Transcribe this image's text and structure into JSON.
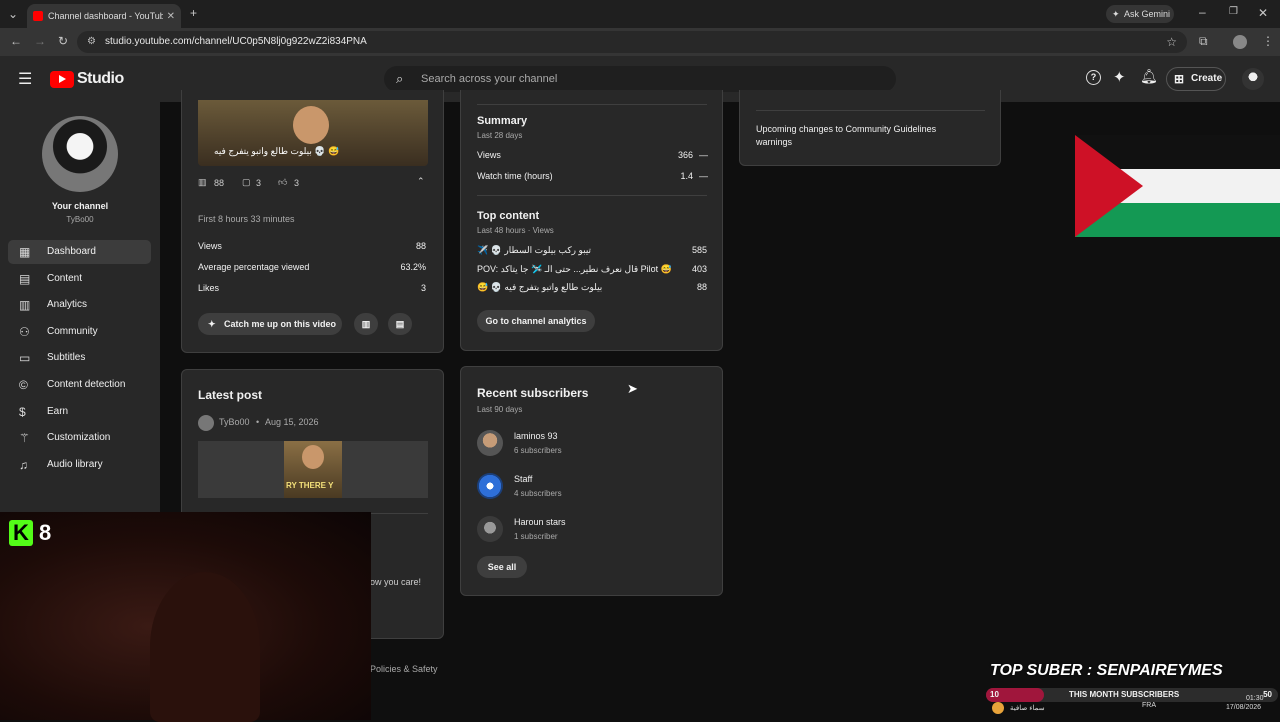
{
  "browser": {
    "tab_title": "Channel dashboard - YouTube Studio",
    "ask_gemini": "Ask Gemini",
    "url": "studio.youtube.com/channel/UC0p5N8lj0g922wZ2i834PNA"
  },
  "header": {
    "logo_text": "Studio",
    "search_placeholder": "Search across your channel",
    "create_label": "Create"
  },
  "sidebar": {
    "your_channel": "Your channel",
    "channel_name": "TyBo00",
    "items": [
      {
        "label": "Dashboard",
        "icon": "dashboard-icon"
      },
      {
        "label": "Content",
        "icon": "content-icon"
      },
      {
        "label": "Analytics",
        "icon": "analytics-icon"
      },
      {
        "label": "Community",
        "icon": "community-icon"
      },
      {
        "label": "Subtitles",
        "icon": "subtitles-icon"
      },
      {
        "label": "Content detection",
        "icon": "copyright-icon"
      },
      {
        "label": "Earn",
        "icon": "dollar-icon"
      },
      {
        "label": "Customization",
        "icon": "wand-icon"
      },
      {
        "label": "Audio library",
        "icon": "audio-library-icon"
      }
    ]
  },
  "latest_video": {
    "thumb_text": "بيلوت طالع واتبو يتفرج فيه 💀 😅",
    "views_count": "88",
    "comments_count": "3",
    "likes_count": "3",
    "period": "First 8 hours 33 minutes",
    "stats": [
      {
        "label": "Views",
        "value": "88"
      },
      {
        "label": "Average percentage viewed",
        "value": "63.2%"
      },
      {
        "label": "Likes",
        "value": "3"
      }
    ],
    "catch_up_label": "Catch me up on this video"
  },
  "latest_post": {
    "title": "Latest post",
    "author": "TyBo00",
    "date": "Aug 15, 2026",
    "thumb_text": "RY THERE Y",
    "partial_text": "ow you care!"
  },
  "analytics": {
    "summary_title": "Summary",
    "summary_period": "Last 28 days",
    "summary_rows": [
      {
        "label": "Views",
        "value": "366",
        "trend": "—"
      },
      {
        "label": "Watch time (hours)",
        "value": "1.4",
        "trend": "—"
      }
    ],
    "top_title": "Top content",
    "top_period": "Last 48 hours · Views",
    "top_rows": [
      {
        "label": "✈️ 💀 تيبو ركب بيلوت السطار",
        "value": "585"
      },
      {
        "label": "POV: قال نعرف نطير... حتى الـ 🛩️ جا يتاكد Pilot 😅",
        "value": "403"
      },
      {
        "label": "😅 💀 بيلوت طالع واتبو يتفرج فيه",
        "value": "88"
      }
    ],
    "go_analytics_label": "Go to channel analytics"
  },
  "recent_subscribers": {
    "title": "Recent subscribers",
    "period": "Last 90 days",
    "items": [
      {
        "name": "laminos 93",
        "subs": "6 subscribers"
      },
      {
        "name": "Staff",
        "subs": "4 subscribers"
      },
      {
        "name": "Haroun stars",
        "subs": "1 subscriber"
      }
    ],
    "see_all_label": "See all"
  },
  "news": {
    "item_title": "Upcoming changes to Community Guidelines warnings"
  },
  "footer": {
    "policies": "Policies & Safety"
  },
  "overlay": {
    "kick_count": "8",
    "top_suber": "TOP SUBER : SENPAIREYMES",
    "bar_left": "10",
    "bar_label": "THIS MONTH SUBSCRIBERS",
    "bar_right": "50",
    "bar_progress": 0.2,
    "weather": "سماء صافية",
    "lang": "FRA",
    "time": "01:30",
    "date": "17/08/2026"
  }
}
